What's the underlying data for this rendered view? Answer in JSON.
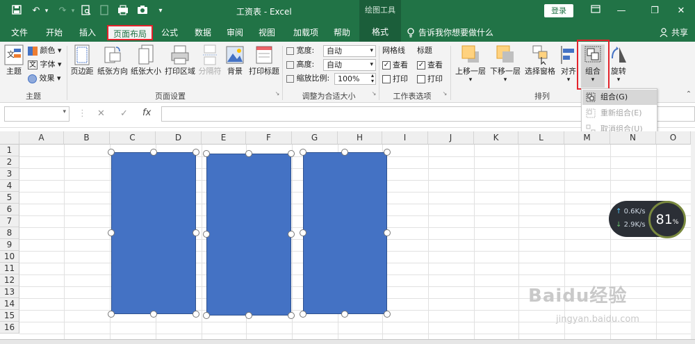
{
  "quick_access": {
    "save_icon": "save-icon",
    "undo_icon": "undo-icon",
    "redo_icon": "redo-icon",
    "preview_icon": "print-preview-icon",
    "new_icon": "new-doc-icon",
    "camera_icon": "camera-icon",
    "scan_icon": "scan-icon",
    "more_icon": "chevron-down-icon"
  },
  "window": {
    "title": "工资表 - Excel",
    "drawing_tools": "绘图工具",
    "login": "登录",
    "share": "共享"
  },
  "tabs": [
    "文件",
    "开始",
    "插入",
    "页面布局",
    "公式",
    "数据",
    "审阅",
    "视图",
    "加载项",
    "帮助",
    "格式"
  ],
  "tell_me": "告诉我你想要做什么",
  "ribbon": {
    "theme": {
      "themes": "主题",
      "colors": "颜色",
      "fonts": "字体",
      "effects": "效果",
      "group": "主题"
    },
    "page_setup": {
      "margins": "页边距",
      "orientation": "纸张方向",
      "size": "纸张大小",
      "print_area": "打印区域",
      "breaks": "分隔符",
      "background": "背景",
      "print_titles": "打印标题",
      "group": "页面设置"
    },
    "scale": {
      "width_label": "宽度:",
      "width_value": "自动",
      "height_label": "高度:",
      "height_value": "自动",
      "scale_label": "缩放比例:",
      "scale_value": "100%",
      "group": "调整为合适大小"
    },
    "sheet_options": {
      "gridlines": "网格线",
      "headings": "标题",
      "view": "查看",
      "print": "打印",
      "group": "工作表选项"
    },
    "arrange": {
      "bring_forward": "上移一层",
      "send_backward": "下移一层",
      "selection_pane": "选择窗格",
      "align": "对齐",
      "group_btn": "组合",
      "rotate": "旋转",
      "group": "排列"
    }
  },
  "group_menu": [
    {
      "label": "组合(G)",
      "enabled": true
    },
    {
      "label": "重新组合(E)",
      "enabled": false
    },
    {
      "label": "取消组合(U)",
      "enabled": false
    }
  ],
  "formula_bar": {
    "cancel": "✕",
    "enter": "✓",
    "fx": "fx",
    "value": ""
  },
  "columns": [
    "A",
    "B",
    "C",
    "D",
    "E",
    "F",
    "G",
    "H",
    "I",
    "J",
    "K",
    "L",
    "M",
    "N",
    "O"
  ],
  "rows": [
    "1",
    "2",
    "3",
    "4",
    "5",
    "6",
    "7",
    "8",
    "9",
    "10",
    "11",
    "12",
    "13",
    "14",
    "15",
    "16"
  ],
  "network": {
    "upload": "0.6K/s",
    "download": "2.9K/s",
    "percent": "81",
    "unit": "%"
  },
  "watermark": {
    "brand": "Baidu经验",
    "url": "jingyan.baidu.com"
  }
}
